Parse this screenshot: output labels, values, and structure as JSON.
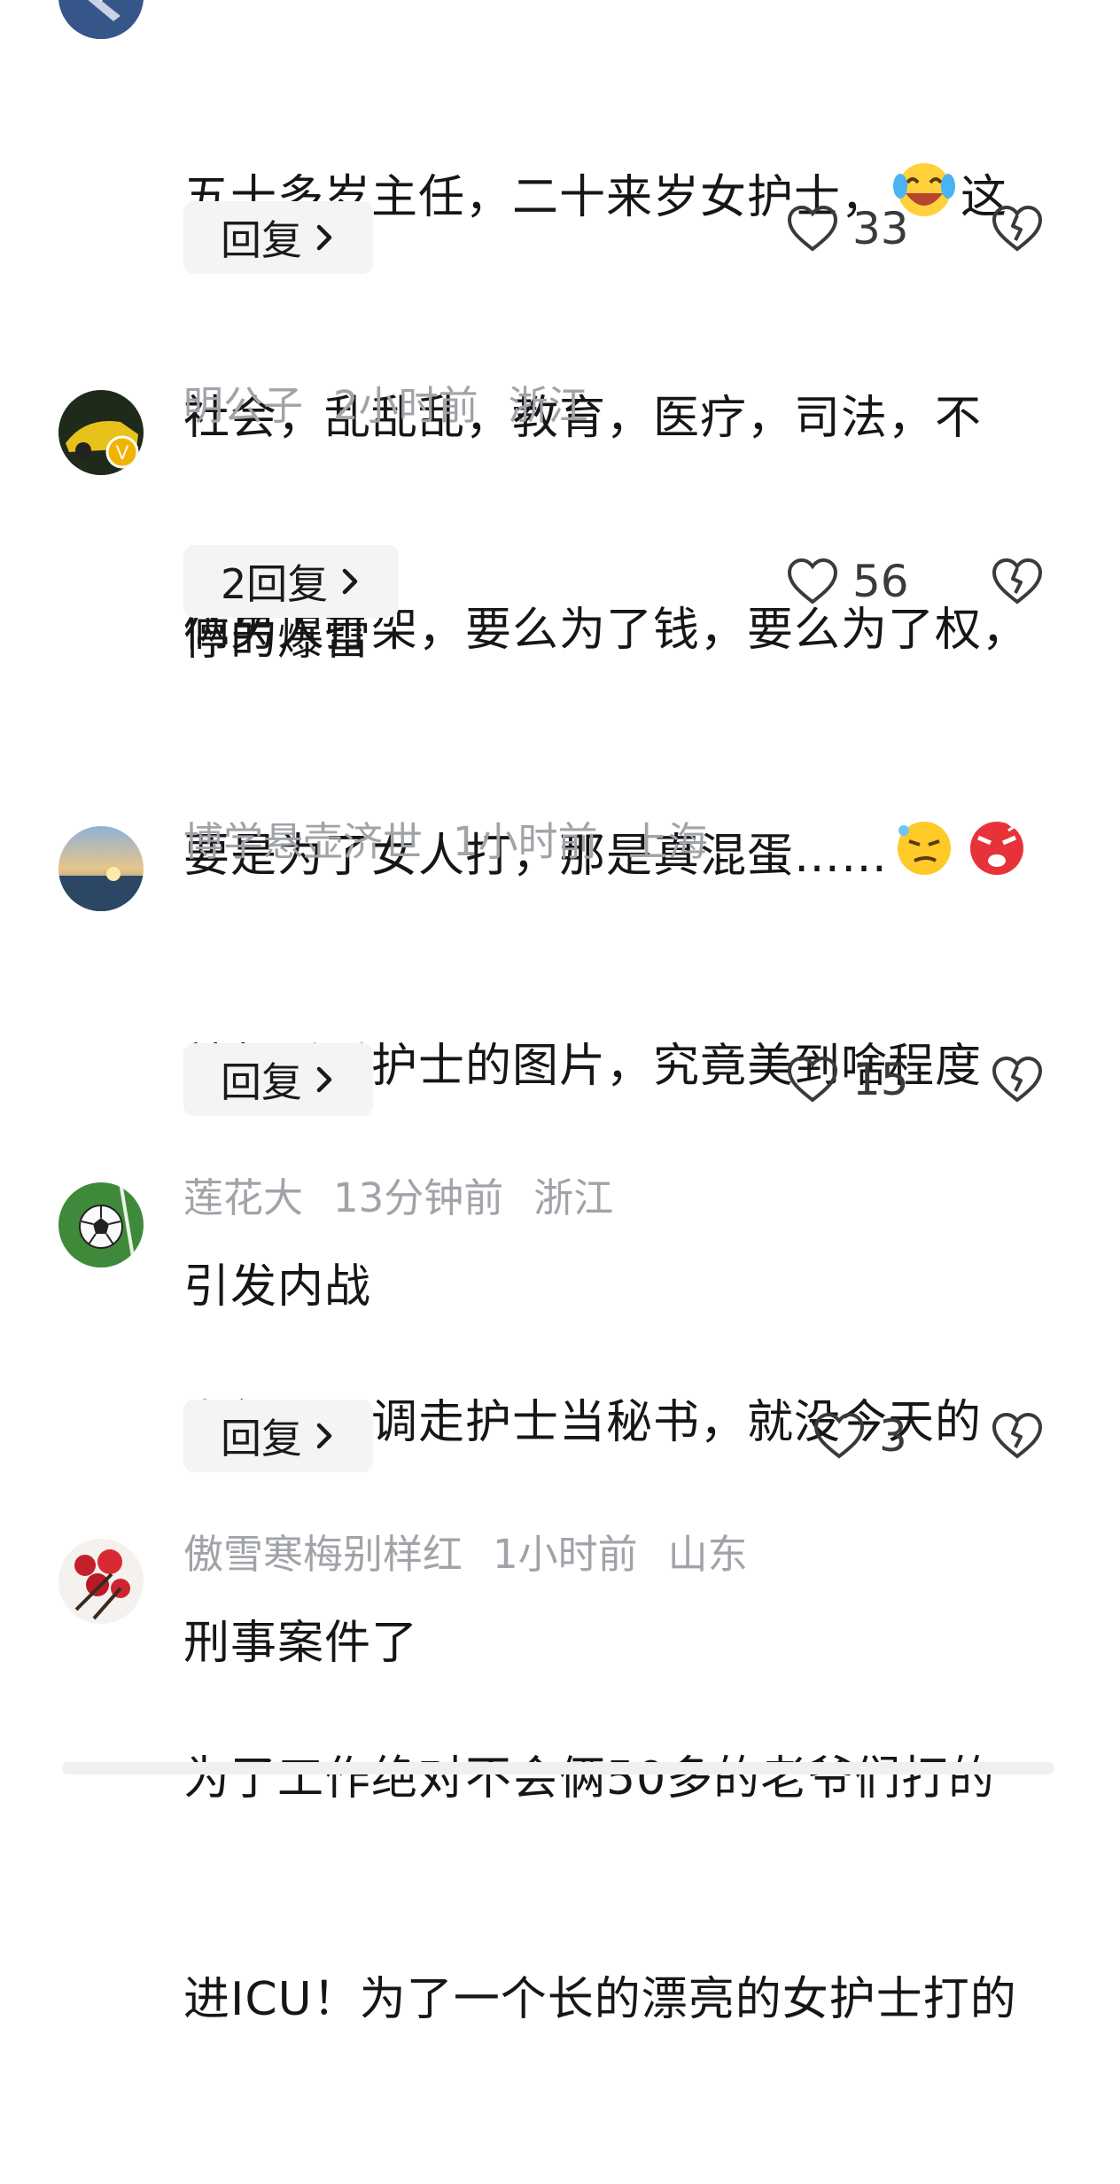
{
  "comments": [
    {
      "meta_user": "",
      "meta_time": "",
      "meta_region": "",
      "text_line1": "五十多岁主任，二十来岁女护士，",
      "text_line1_tail": "这",
      "text_line2": "社会，乱乱乱，教育，医疗，司法，不",
      "text_line3": "停的爆雷",
      "reply_label": "回复",
      "likes": "33",
      "avatar_icon": "jet-avatar-icon",
      "emoji_icons": [
        "laughing-crying-emoji-icon"
      ]
    },
    {
      "meta_user": "明公子",
      "meta_time": "2小时前",
      "meta_region": "浙江",
      "text_line1": "俩男人打架，要么为了钱，要么为了权，",
      "text_line2": "要是为了女人打，那是真混蛋……",
      "reply_label": "2回复",
      "likes": "56",
      "avatar_icon": "sports-car-avatar-icon",
      "emoji_icons": [
        "smirk-emoji-icon",
        "angry-emoji-icon",
        "slipper-emoji-icon"
      ]
    },
    {
      "meta_user": "博学悬壶济世",
      "meta_time": "1小时前",
      "meta_region": "上海",
      "text_line1": "就想看看护士的图片，究竟美到啥程度",
      "text_line2": "引发内战",
      "reply_label": "回复",
      "likes": "15",
      "avatar_icon": "sunset-sea-avatar-icon"
    },
    {
      "meta_user": "莲花大",
      "meta_time": "13分钟前",
      "meta_region": "浙江",
      "text_line1": "上级因早调走护士当秘书，就没今天的",
      "text_line2": "刑事案件了",
      "reply_label": "回复",
      "likes": "3",
      "avatar_icon": "soccer-ball-avatar-icon"
    },
    {
      "meta_user": "傲雪寒梅别样红",
      "meta_time": "1小时前",
      "meta_region": "山东",
      "text_line1": "为了工作绝对不会俩50多的老爷们打的",
      "text_line2": "进ICU！为了一个长的漂亮的女护士打的",
      "avatar_icon": "red-flowers-avatar-icon"
    }
  ],
  "icons": {
    "like": "heart-outline-icon",
    "dislike": "broken-heart-icon",
    "reply_chevron": "chevron-right-icon"
  },
  "colors": {
    "meta_text": "#a0a3a8",
    "body_text": "#161616",
    "reply_bg": "#f3f4f6"
  }
}
